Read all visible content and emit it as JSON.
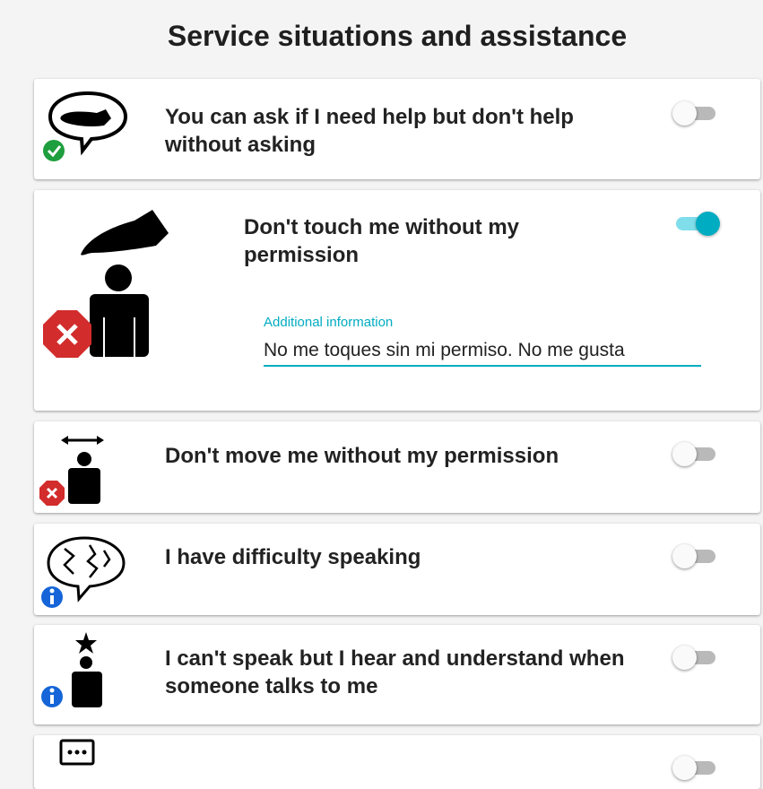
{
  "page": {
    "title": "Service situations and assistance"
  },
  "items": [
    {
      "label": "You can ask if I need help but don't help without asking",
      "status": "check",
      "enabled": false
    },
    {
      "label": "Don't touch me without my permission",
      "status": "cross",
      "enabled": true,
      "field": {
        "label": "Additional information",
        "value": "No me toques sin mi permiso. No me gusta"
      }
    },
    {
      "label": "Don't move me without my permission",
      "status": "cross",
      "enabled": false
    },
    {
      "label": "I have difficulty speaking",
      "status": "info",
      "enabled": false
    },
    {
      "label": "I can't speak but I hear and understand when someone talks to me",
      "status": "info",
      "enabled": false
    },
    {
      "label": "",
      "enabled": false
    }
  ],
  "colors": {
    "accent": "#00acc1",
    "accent_track": "#7fdeea",
    "check": "#1e9e3e",
    "cross": "#d22c2c",
    "info": "#1565d8"
  }
}
